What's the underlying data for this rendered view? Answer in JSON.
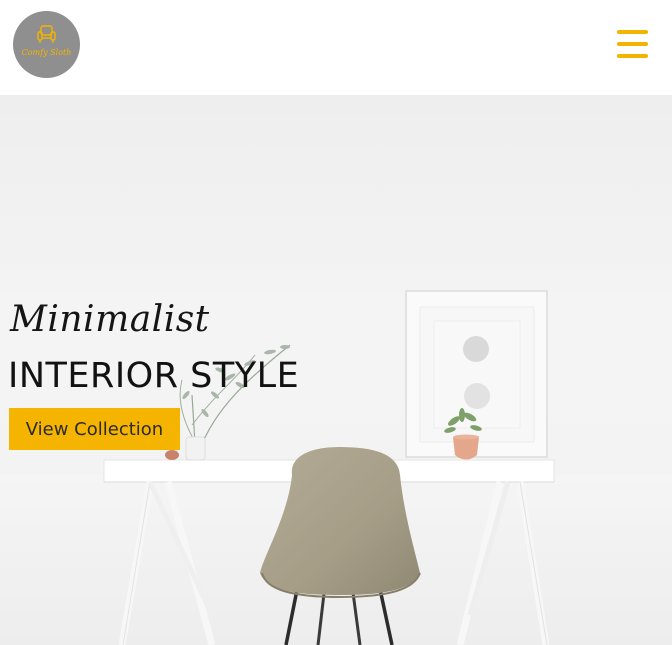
{
  "header": {
    "logo": {
      "text": "Comfy Sloth",
      "icon": "armchair-icon",
      "background": "#8f8f8f",
      "text_color": "#f4b400"
    },
    "menu_icon": "hamburger-menu-icon",
    "accent": "#f2b400"
  },
  "hero": {
    "subtitle": "Minimalist",
    "title": "INTERIOR STYLE",
    "cta_label": "View Collection",
    "cta_color": "#f4b400"
  }
}
